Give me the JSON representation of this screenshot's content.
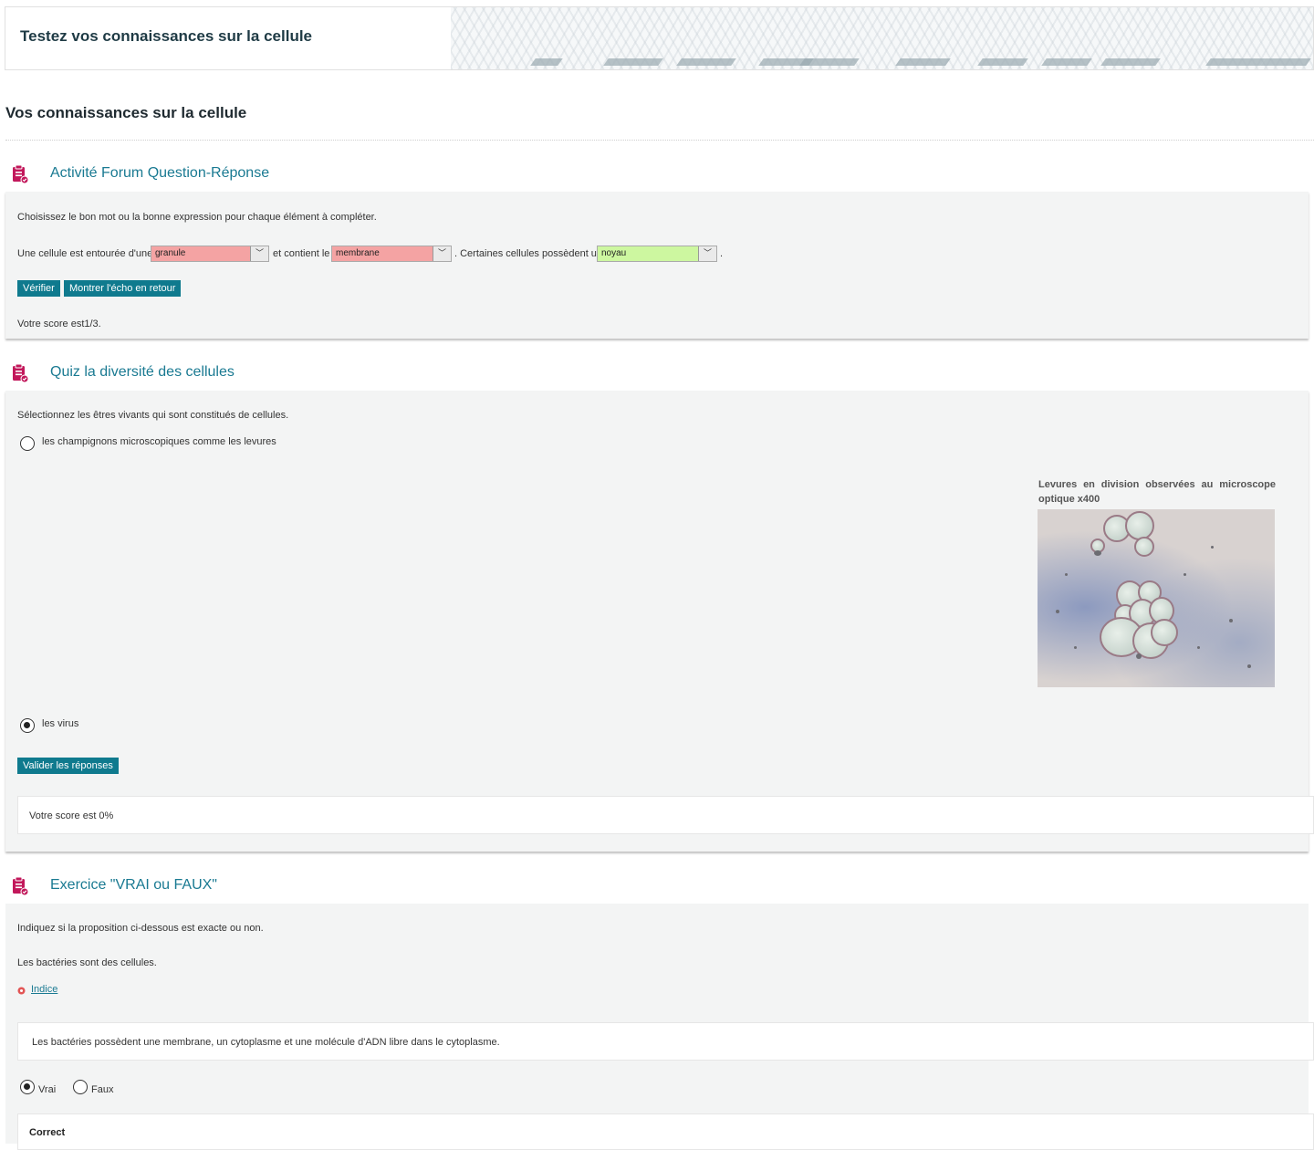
{
  "page": {
    "banner_title": "Testez vos connaissances sur la cellule",
    "section_title": "Vos connaissances sur la cellule"
  },
  "activity1": {
    "title": "Activité Forum Question-Réponse",
    "instruction": "Choisissez le bon mot ou la bonne expression pour chaque élément à compléter.",
    "sentence": {
      "part1": "Une cellule est entourée d'une",
      "part2": "et contient le",
      "part3": ". Certaines cellules possèdent un",
      "part4": "."
    },
    "selects": [
      {
        "value": "granule",
        "status": "incorrect",
        "color": "#f4a3a3"
      },
      {
        "value": "membrane",
        "status": "incorrect",
        "color": "#f4a3a3"
      },
      {
        "value": "noyau",
        "status": "correct",
        "color": "#cdf7a0"
      }
    ],
    "verify_label": "Vérifier",
    "feedback_label": "Montrer l'écho en retour",
    "score_text": "Votre score est1/3."
  },
  "activity2": {
    "title": "Quiz la diversité des cellules",
    "instruction": "Sélectionnez les êtres vivants qui sont constitués de cellules.",
    "options": [
      {
        "label": "les champignons microscopiques comme les levures",
        "selected": false
      },
      {
        "label": "les virus",
        "selected": true
      }
    ],
    "image_caption": "Levures en division observées au microscope optique x400",
    "validate_label": "Valider les réponses",
    "score_text": "Votre score est 0%"
  },
  "activity3": {
    "title": "Exercice \"VRAI ou FAUX\"",
    "instruction": "Indiquez si la proposition ci-dessous est exacte ou non.",
    "statement": "Les bactéries sont des cellules.",
    "hint_label": "Indice",
    "hint_text": "Les bactéries possèdent une membrane, un cytoplasme et une molécule d'ADN libre dans le cytoplasme.",
    "options": [
      {
        "label": "Vrai",
        "selected": true
      },
      {
        "label": "Faux",
        "selected": false
      }
    ],
    "result": "Correct"
  },
  "colors": {
    "accent": "#0f7a8e",
    "title_blue": "#1a7a92",
    "icon": "#c2185b",
    "panel_bg": "#f3f4f4"
  }
}
